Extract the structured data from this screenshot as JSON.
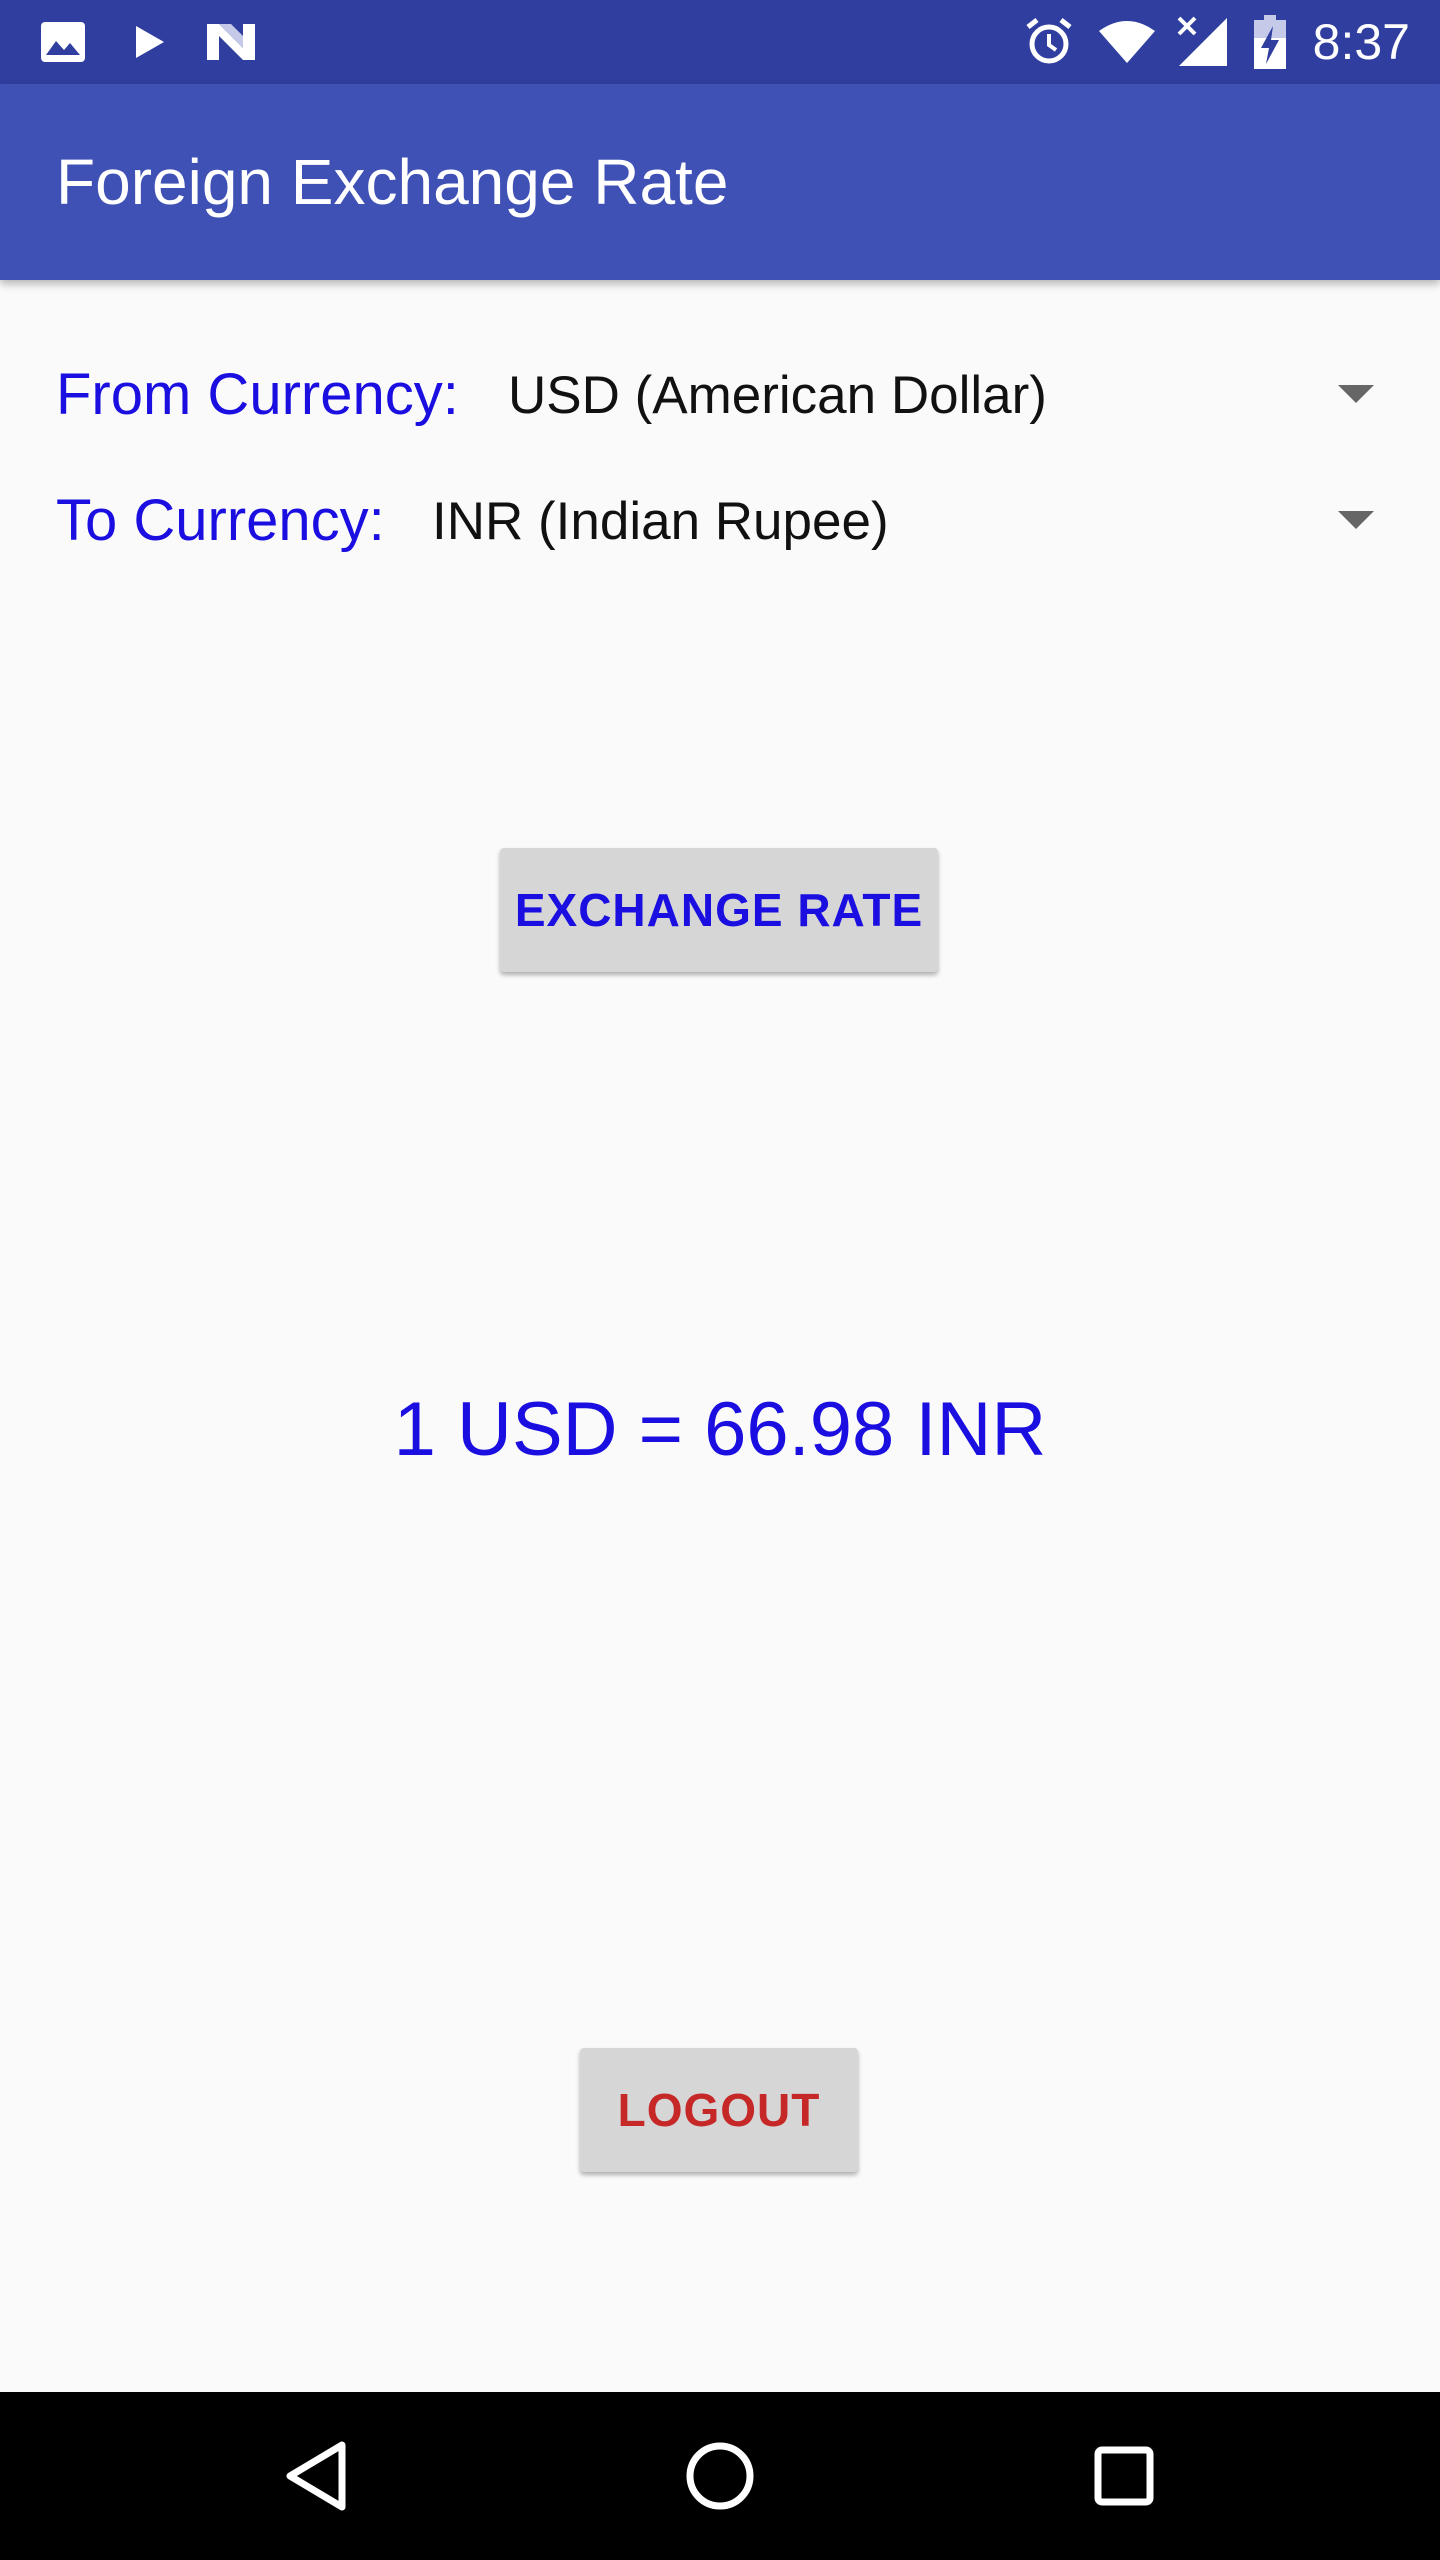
{
  "status_bar": {
    "time": "8:37",
    "left_icons": [
      "image-icon",
      "play-icon",
      "n-logo-icon"
    ],
    "right_icons": [
      "alarm-icon",
      "wifi-icon",
      "signal-icon",
      "battery-charging-icon"
    ]
  },
  "app_bar": {
    "title": "Foreign Exchange Rate",
    "color": "#3f51b5",
    "status_color": "#303f9f"
  },
  "from_currency": {
    "label": "From Currency:",
    "selected": "USD (American Dollar)"
  },
  "to_currency": {
    "label": "To Currency:",
    "selected": "INR (Indian Rupee)"
  },
  "exchange_button": {
    "label": "EXCHANGE RATE"
  },
  "result": {
    "text": "1 USD = 66.98 INR"
  },
  "logout_button": {
    "label": "LOGOUT"
  },
  "nav_bar": {
    "buttons": [
      "back-icon",
      "home-icon",
      "recents-icon"
    ]
  },
  "colors": {
    "label_blue": "#1a0ee0",
    "logout_red": "#c62828",
    "background": "#fafafa"
  }
}
